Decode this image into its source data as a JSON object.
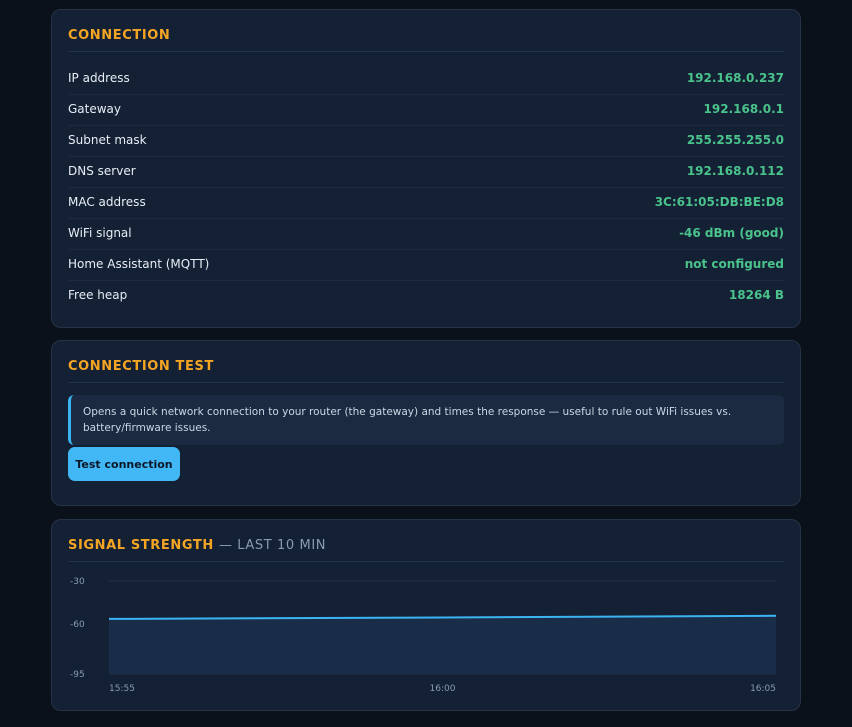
{
  "connection": {
    "title": "CONNECTION",
    "rows": [
      {
        "label": "IP address",
        "value": "192.168.0.237"
      },
      {
        "label": "Gateway",
        "value": "192.168.0.1"
      },
      {
        "label": "Subnet mask",
        "value": "255.255.255.0"
      },
      {
        "label": "DNS server",
        "value": "192.168.0.112"
      },
      {
        "label": "MAC address",
        "value": "3C:61:05:DB:BE:D8"
      },
      {
        "label": "WiFi signal",
        "value": "-46 dBm (good)"
      },
      {
        "label": "Home Assistant (MQTT)",
        "value": "not configured"
      },
      {
        "label": "Free heap",
        "value": "18264 B"
      }
    ]
  },
  "connection_test": {
    "title": "CONNECTION TEST",
    "note": "Opens a quick network connection to your router (the gateway) and times the response — useful to rule out WiFi issues vs. battery/firmware issues.",
    "button_label": "Test connection"
  },
  "signal": {
    "title": "SIGNAL STRENGTH",
    "subtitle": "— LAST 10 MIN"
  },
  "colors": {
    "accent": "#f5a524",
    "value_green": "#4ac28c",
    "button_blue": "#41b8f5",
    "line_blue": "#3bb4f2"
  },
  "chart_data": {
    "type": "area",
    "title": "SIGNAL STRENGTH — LAST 10 MIN",
    "xlabel": "",
    "ylabel": "",
    "x": [
      "15:55",
      "16:00",
      "16:05"
    ],
    "x_ticks": [
      "15:55",
      "16:00",
      "16:05"
    ],
    "y_ticks": [
      -30,
      -60,
      -95
    ],
    "ylim": [
      -95,
      -30
    ],
    "series": [
      {
        "values": [
          -56.5,
          -55.5,
          -54.3
        ]
      }
    ],
    "grid": true,
    "legend": "none"
  }
}
